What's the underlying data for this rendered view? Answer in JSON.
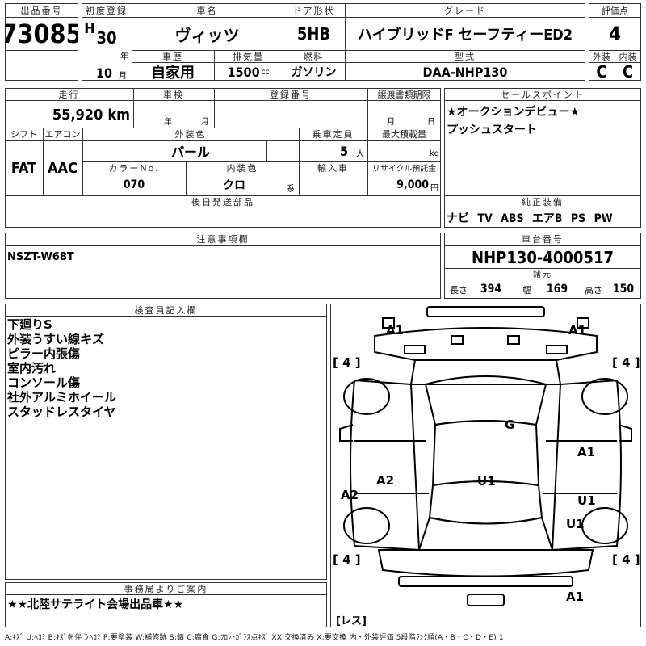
{
  "header": {
    "lot_label": "出品番号",
    "lot_no": "73085",
    "first_reg_label": "初度登録",
    "era": "H",
    "year": "30",
    "year_unit": "年",
    "month": "10",
    "month_unit": "月",
    "car_name_label": "車名",
    "car_name": "ヴィッツ",
    "door_label": "ドア形状",
    "door": "5HB",
    "grade_label": "グレード",
    "grade": "ハイブリッドF セーフティーED2",
    "score_label": "評価点",
    "score": "4",
    "history_label": "車歴",
    "history": "自家用",
    "displacement_label": "排気量",
    "displacement": "1500",
    "displacement_unit": "cc",
    "fuel_label": "燃料",
    "fuel": "ガソリン",
    "model_label": "型式",
    "model": "DAA-NHP130",
    "ext_label": "外装",
    "ext": "C",
    "int_label": "内装",
    "int": "C"
  },
  "info": {
    "mileage_label": "走行",
    "mileage": "55,920",
    "mileage_unit": "km",
    "inspection_label": "車検",
    "inspection_year_unit": "年",
    "inspection_month_unit": "月",
    "reg_no_label": "登録番号",
    "transfer_label": "譲渡書類期限",
    "transfer_month_unit": "月",
    "transfer_day_unit": "日",
    "shift_label": "シフト",
    "shift": "FAT",
    "ac_label": "エアコン",
    "ac": "AAC",
    "color_label": "外装色",
    "color": "パール",
    "capacity_label": "乗車定員",
    "capacity": "5",
    "capacity_unit": "人",
    "max_load_label": "最大積載量",
    "max_load_unit": "kg",
    "color_no_label": "カラーNo.",
    "color_no": "070",
    "int_color_label": "内装色",
    "int_color": "クロ",
    "int_color_unit": "系",
    "import_label": "輸入車",
    "recycle_label": "リサイクル預託金",
    "recycle": "9,000",
    "recycle_unit": "円",
    "later_parts_label": "後日発送部品"
  },
  "sales": {
    "label": "セールスポイント",
    "lines": [
      "★オークションデビュー★",
      "プッシュスタート"
    ]
  },
  "equipment": {
    "label": "純正装備",
    "value": "ナビ TV ABS エアB PS PW"
  },
  "notes": {
    "label": "注意事項欄",
    "value": "NSZT-W68T"
  },
  "chassis": {
    "label": "車台番号",
    "value": "NHP130-4000517",
    "specs_label": "諸元",
    "length_label": "長さ",
    "length": "394",
    "width_label": "幅",
    "width": "169",
    "height_label": "高さ",
    "height": "150"
  },
  "inspector": {
    "label": "検査員記入欄",
    "lines": [
      "下廻りS",
      "外装うすい線キズ",
      "ピラー内張傷",
      "室内汚れ",
      "コンソール傷",
      "社外アルミホイール",
      "スタッドレスタイヤ"
    ]
  },
  "office": {
    "label": "事務局よりご案内",
    "value": "★★北陸サテライト会場出品車★★"
  },
  "diagram": {
    "damage": [
      {
        "code": "A1"
      },
      {
        "code": "A1"
      },
      {
        "code": "G"
      },
      {
        "code": "A1"
      },
      {
        "code": "A2"
      },
      {
        "code": "U1"
      },
      {
        "code": "A2"
      },
      {
        "code": "U1"
      },
      {
        "code": "U1"
      },
      {
        "code": "A1"
      }
    ],
    "tires": [
      "[ 4 ]",
      "[ 4 ]",
      "[ 4 ]",
      "[ 4 ]"
    ],
    "spare": "[レス]"
  },
  "legend": "A:ｷｽﾞ U:ﾍｺﾐ B:ｷｽﾞを伴うﾍｺﾐ P:要塗装 W:補修跡 S:錆 C:腐食 G:ﾌﾛﾝﾄｶﾞﾗｽ点ｷｽﾞ XX:交換済み X:要交換 内・外装評価 5段階ﾗﾝｸ順(A・B・C・D・E) 1"
}
